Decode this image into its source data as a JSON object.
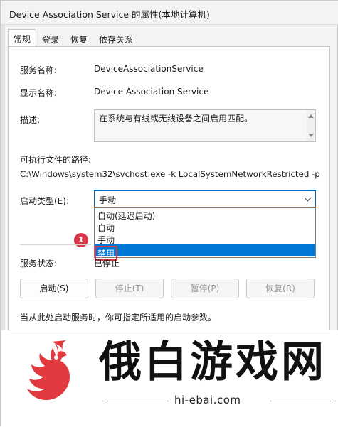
{
  "window": {
    "title": "Device Association Service 的属性(本地计算机)"
  },
  "tabs": [
    "常规",
    "登录",
    "恢复",
    "依存关系"
  ],
  "general": {
    "service_name_label": "服务名称:",
    "service_name_value": "DeviceAssociationService",
    "display_name_label": "显示名称:",
    "display_name_value": "Device Association Service",
    "description_label": "描述:",
    "description_value": "在系统与有线或无线设备之间启用匹配。",
    "exe_path_label": "可执行文件的路径:",
    "exe_path_value": "C:\\Windows\\system32\\svchost.exe -k LocalSystemNetworkRestricted -p",
    "startup_type_label": "启动类型(E):",
    "startup_type_value": "手动",
    "startup_options": [
      "自动(延迟启动)",
      "自动",
      "手动",
      "禁用"
    ],
    "selected_option_index": 3,
    "service_status_label": "服务状态:",
    "service_status_value": "已停止",
    "hint_text": "当从此处启动服务时，你可指定所适用的启动参数。"
  },
  "buttons": {
    "start": "启动(S)",
    "stop": "停止(T)",
    "pause": "暂停(P)",
    "resume": "恢复(R)"
  },
  "annotation": {
    "step_badge": "1"
  },
  "watermark": {
    "brand_text": "俄白游戏网",
    "url": "hi-ebai.com"
  },
  "colors": {
    "accent": "#0078d7",
    "badge": "#d9364a",
    "logo": "#e0393e"
  }
}
